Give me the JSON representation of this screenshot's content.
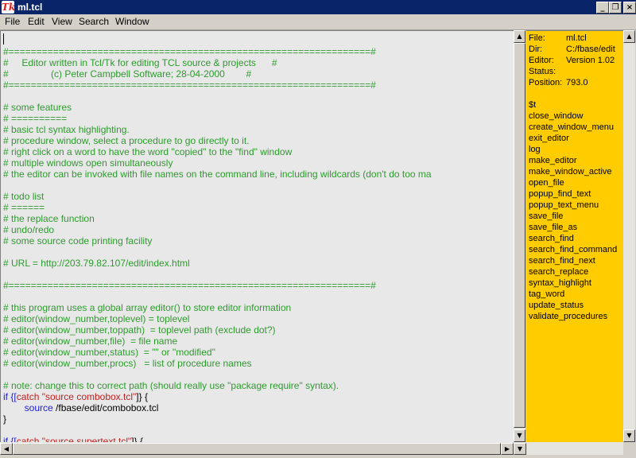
{
  "window": {
    "logo": "Tk",
    "title": "ml.tcl",
    "btn_min": "_",
    "btn_max": "❐",
    "btn_close": "×"
  },
  "menu": {
    "items": [
      {
        "label": "File"
      },
      {
        "label": "Edit"
      },
      {
        "label": "View"
      },
      {
        "label": "Search"
      },
      {
        "label": "Window"
      }
    ]
  },
  "editor": {
    "lines": [
      [
        {
          "t": "",
          "c": "cm"
        }
      ],
      [
        {
          "t": "#=================================================================#",
          "c": "cm"
        }
      ],
      [
        {
          "t": "#     Editor written in Tcl/Tk for editing TCL source & projects      #",
          "c": "cm"
        }
      ],
      [
        {
          "t": "#                (c) Peter Campbell Software; 28-04-2000        #",
          "c": "cm"
        }
      ],
      [
        {
          "t": "#=================================================================#",
          "c": "cm"
        }
      ],
      [
        {
          "t": "",
          "c": "cm"
        }
      ],
      [
        {
          "t": "# some features",
          "c": "cm"
        }
      ],
      [
        {
          "t": "# ==========",
          "c": "cm"
        }
      ],
      [
        {
          "t": "# basic tcl syntax highlighting.",
          "c": "cm"
        }
      ],
      [
        {
          "t": "# procedure window, select a procedure to go directly to it.",
          "c": "cm"
        }
      ],
      [
        {
          "t": "# right click on a word to have the word \"copied\" to the \"find\" window",
          "c": "cm"
        }
      ],
      [
        {
          "t": "# multiple windows open simultaneously",
          "c": "cm"
        }
      ],
      [
        {
          "t": "# the editor can be invoked with file names on the command line, including wildcards (don't do too ma",
          "c": "cm"
        }
      ],
      [
        {
          "t": "",
          "c": "cm"
        }
      ],
      [
        {
          "t": "# todo list",
          "c": "cm"
        }
      ],
      [
        {
          "t": "# ======",
          "c": "cm"
        }
      ],
      [
        {
          "t": "# the replace function",
          "c": "cm"
        }
      ],
      [
        {
          "t": "# undo/redo",
          "c": "cm"
        }
      ],
      [
        {
          "t": "# some source code printing facility",
          "c": "cm"
        }
      ],
      [
        {
          "t": "",
          "c": "cm"
        }
      ],
      [
        {
          "t": "# URL = http://203.79.82.107/edit/index.html",
          "c": "cm"
        }
      ],
      [
        {
          "t": "",
          "c": "cm"
        }
      ],
      [
        {
          "t": "#=================================================================#",
          "c": "cm"
        }
      ],
      [
        {
          "t": "",
          "c": "cm"
        }
      ],
      [
        {
          "t": "# this program uses a global array editor() to store editor information",
          "c": "cm"
        }
      ],
      [
        {
          "t": "# editor(window_number,toplevel) = toplevel",
          "c": "cm"
        }
      ],
      [
        {
          "t": "# editor(window_number,toppath)  = toplevel path (exclude dot?)",
          "c": "cm"
        }
      ],
      [
        {
          "t": "# editor(window_number,file)  = file name",
          "c": "cm"
        }
      ],
      [
        {
          "t": "# editor(window_number,status)  = \"\" or \"modified\"",
          "c": "cm"
        }
      ],
      [
        {
          "t": "# editor(window_number,procs)   = list of procedure names",
          "c": "cm"
        }
      ],
      [
        {
          "t": "",
          "c": "cm"
        }
      ],
      [
        {
          "t": "# note: change this to correct path (should really use \"package require\" syntax).",
          "c": "cm"
        }
      ],
      [
        {
          "t": "if {[",
          "c": "kw"
        },
        {
          "t": "catch ",
          "c": "str"
        },
        {
          "t": "\"source combobox.tcl\"",
          "c": "str"
        },
        {
          "t": "]} {",
          "c": "plain"
        }
      ],
      [
        {
          "t": "        ",
          "c": "plain"
        },
        {
          "t": "source",
          "c": "kw"
        },
        {
          "t": " /fbase/edit/combobox.tcl",
          "c": "plain"
        }
      ],
      [
        {
          "t": "}",
          "c": "plain"
        }
      ],
      [
        {
          "t": "",
          "c": "plain"
        }
      ],
      [
        {
          "t": "if {[",
          "c": "kw"
        },
        {
          "t": "catch ",
          "c": "str"
        },
        {
          "t": "\"source supertext.tcl\"",
          "c": "str"
        },
        {
          "t": "]} {",
          "c": "plain"
        }
      ]
    ]
  },
  "status": {
    "rows": [
      {
        "key": "File:",
        "value": "ml.tcl"
      },
      {
        "key": "Dir:",
        "value": "C:/fbase/edit"
      },
      {
        "key": "Editor:",
        "value": "Version 1.02"
      },
      {
        "key": "Status:",
        "value": ""
      },
      {
        "key": "Position:",
        "value": "793.0"
      }
    ]
  },
  "procedures": [
    "$t",
    "close_window",
    "create_window_menu",
    "exit_editor",
    "log",
    "make_editor",
    "make_window_active",
    "open_file",
    "popup_find_text",
    "popup_text_menu",
    "save_file",
    "save_file_as",
    "search_find",
    "search_find_command",
    "search_find_next",
    "search_replace",
    "syntax_highlight",
    "tag_word",
    "update_status",
    "validate_procedures"
  ],
  "scroll": {
    "up": "▲",
    "down": "▼",
    "left": "◀",
    "right": "▶"
  }
}
